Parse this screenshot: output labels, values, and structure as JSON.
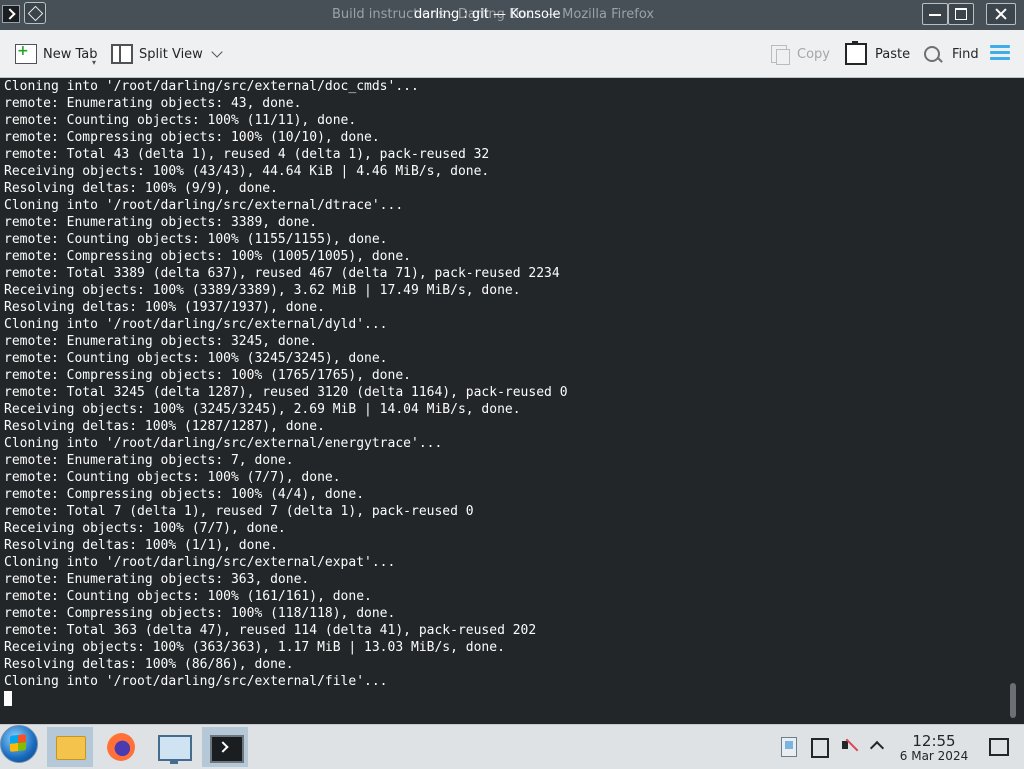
{
  "window": {
    "title_background": "Build instructions - Darling Docs — Mozilla Firefox",
    "title": "darling : git — Konsole"
  },
  "toolbar": {
    "new_tab": "New Tab",
    "split_view": "Split View",
    "copy": "Copy",
    "paste": "Paste",
    "find": "Find"
  },
  "terminal": {
    "lines": [
      "Cloning into '/root/darling/src/external/doc_cmds'...",
      "remote: Enumerating objects: 43, done.",
      "remote: Counting objects: 100% (11/11), done.",
      "remote: Compressing objects: 100% (10/10), done.",
      "remote: Total 43 (delta 1), reused 4 (delta 1), pack-reused 32",
      "Receiving objects: 100% (43/43), 44.64 KiB | 4.46 MiB/s, done.",
      "Resolving deltas: 100% (9/9), done.",
      "Cloning into '/root/darling/src/external/dtrace'...",
      "remote: Enumerating objects: 3389, done.",
      "remote: Counting objects: 100% (1155/1155), done.",
      "remote: Compressing objects: 100% (1005/1005), done.",
      "remote: Total 3389 (delta 637), reused 467 (delta 71), pack-reused 2234",
      "Receiving objects: 100% (3389/3389), 3.62 MiB | 17.49 MiB/s, done.",
      "Resolving deltas: 100% (1937/1937), done.",
      "Cloning into '/root/darling/src/external/dyld'...",
      "remote: Enumerating objects: 3245, done.",
      "remote: Counting objects: 100% (3245/3245), done.",
      "remote: Compressing objects: 100% (1765/1765), done.",
      "remote: Total 3245 (delta 1287), reused 3120 (delta 1164), pack-reused 0",
      "Receiving objects: 100% (3245/3245), 2.69 MiB | 14.04 MiB/s, done.",
      "Resolving deltas: 100% (1287/1287), done.",
      "Cloning into '/root/darling/src/external/energytrace'...",
      "remote: Enumerating objects: 7, done.",
      "remote: Counting objects: 100% (7/7), done.",
      "remote: Compressing objects: 100% (4/4), done.",
      "remote: Total 7 (delta 1), reused 7 (delta 1), pack-reused 0",
      "Receiving objects: 100% (7/7), done.",
      "Resolving deltas: 100% (1/1), done.",
      "Cloning into '/root/darling/src/external/expat'...",
      "remote: Enumerating objects: 363, done.",
      "remote: Counting objects: 100% (161/161), done.",
      "remote: Compressing objects: 100% (118/118), done.",
      "remote: Total 363 (delta 47), reused 114 (delta 41), pack-reused 202",
      "Receiving objects: 100% (363/363), 1.17 MiB | 13.03 MiB/s, done.",
      "Resolving deltas: 100% (86/86), done.",
      "Cloning into '/root/darling/src/external/file'..."
    ]
  },
  "taskbar": {
    "time": "12:55",
    "date": "6 Mar 2024",
    "apps": [
      "start-icon",
      "file-manager-icon",
      "firefox-icon",
      "system-settings-icon",
      "konsole-icon"
    ]
  },
  "colors": {
    "terminal_bg": "#232629",
    "terminal_fg": "#fcfcfc",
    "accent": "#3daee9"
  }
}
